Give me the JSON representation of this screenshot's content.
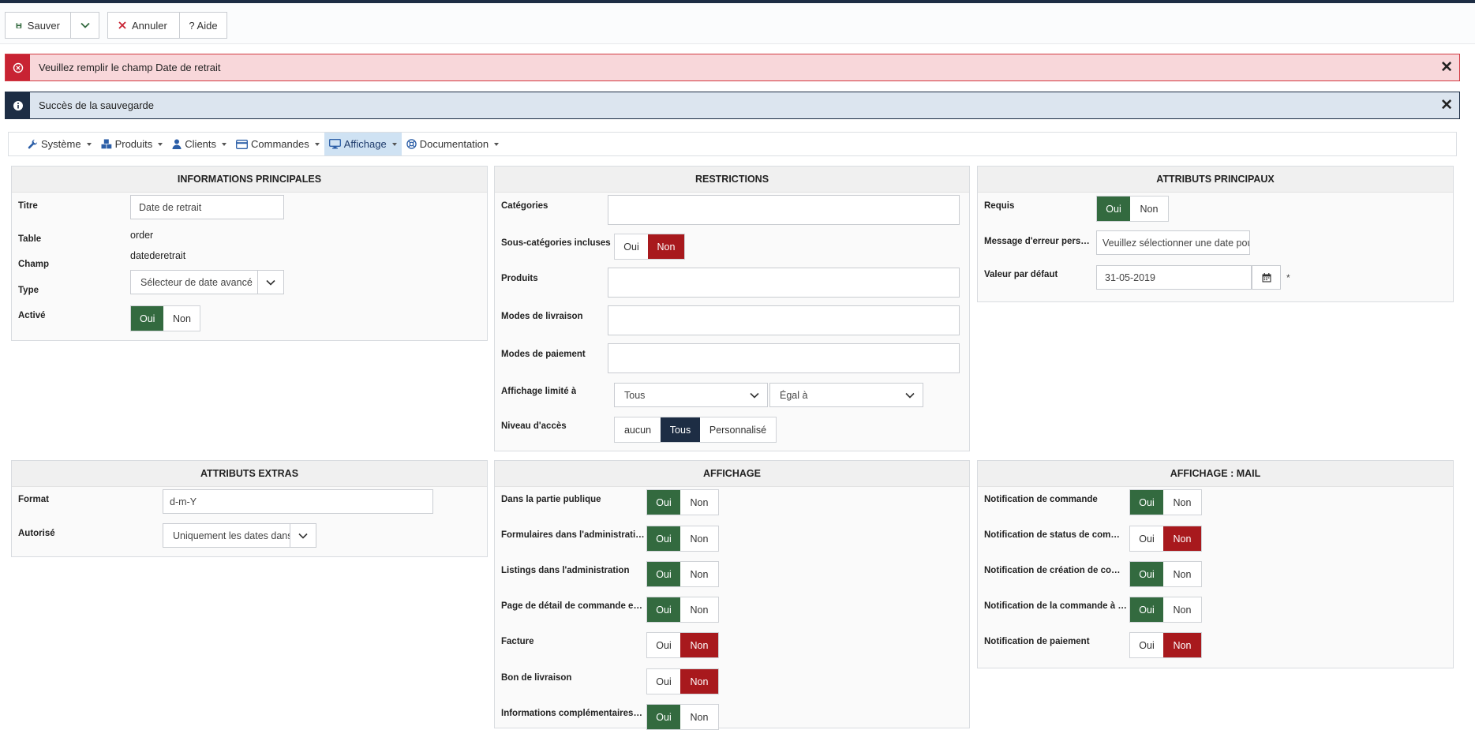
{
  "toolbar": {
    "save": "Sauver",
    "cancel": "Annuler",
    "help": "? Aide"
  },
  "alerts": {
    "error": "Veuillez remplir le champ Date de retrait",
    "success": "Succès de la sauvegarde",
    "close": "✕"
  },
  "menu": {
    "items": [
      {
        "label": "Système"
      },
      {
        "label": "Produits"
      },
      {
        "label": "Clients"
      },
      {
        "label": "Commandes"
      },
      {
        "label": "Affichage"
      },
      {
        "label": "Documentation"
      }
    ],
    "active": "Affichage"
  },
  "main_info": {
    "title": "INFORMATIONS PRINCIPALES",
    "labels": {
      "titre": "Titre",
      "table": "Table",
      "champ": "Champ",
      "type": "Type",
      "active": "Activé"
    },
    "values": {
      "titre": "Date de retrait",
      "table": "order",
      "champ": "datederetrait",
      "type": "Sélecteur de date avancé"
    },
    "active_toggle": {
      "yes": "Oui",
      "no": "Non",
      "selected": "Oui"
    }
  },
  "restrictions": {
    "title": "RESTRICTIONS",
    "labels": {
      "categories": "Catégories",
      "subcats": "Sous-catégories incluses",
      "products": "Produits",
      "delivery": "Modes de livraison",
      "payment": "Modes de paiement",
      "display_limited": "Affichage limité à",
      "access": "Niveau d'accès"
    },
    "subcats_toggle": {
      "yes": "Oui",
      "no": "Non",
      "selected": "Non"
    },
    "display_limited_select1": "Tous",
    "display_limited_select2": "Égal à",
    "access_options": [
      "aucun",
      "Tous",
      "Personnalisé"
    ],
    "access_selected": "Tous"
  },
  "main_attrs": {
    "title": "ATTRIBUTS PRINCIPAUX",
    "labels": {
      "required": "Requis",
      "error_msg": "Message d'erreur personnalisé",
      "default": "Valeur par défaut"
    },
    "required_toggle": {
      "yes": "Oui",
      "no": "Non",
      "selected": "Oui"
    },
    "error_msg_value": "Veuillez sélectionner une date pour le retrait",
    "default_value": "31-05-2019",
    "required_marker": "*"
  },
  "extra_attrs": {
    "title": "ATTRIBUTS EXTRAS",
    "labels": {
      "format": "Format",
      "allowed": "Autorisé"
    },
    "format_value": "d-m-Y",
    "allowed_value": "Uniquement les dates dans le futur"
  },
  "display": {
    "title": "AFFICHAGE",
    "rows": [
      {
        "label": "Dans la partie publique",
        "selected": "Oui"
      },
      {
        "label": "Formulaires dans l'administration",
        "selected": "Oui"
      },
      {
        "label": "Listings dans l'administration",
        "selected": "Oui"
      },
      {
        "label": "Page de détail de commande en partie publique",
        "selected": "Oui"
      },
      {
        "label": "Facture",
        "selected": "Non"
      },
      {
        "label": "Bon de livraison",
        "selected": "Non"
      },
      {
        "label": "Informations complémentaires de commande",
        "selected": "Oui"
      }
    ],
    "yes": "Oui",
    "no": "Non"
  },
  "display_mail": {
    "title": "AFFICHAGE : MAIL",
    "rows": [
      {
        "label": "Notification de commande",
        "selected": "Oui"
      },
      {
        "label": "Notification de status de commande",
        "selected": "Non"
      },
      {
        "label": "Notification de création de commande",
        "selected": "Oui"
      },
      {
        "label": "Notification de la commande à l'administrateur",
        "selected": "Oui"
      },
      {
        "label": "Notification de paiement",
        "selected": "Non"
      }
    ],
    "yes": "Oui",
    "no": "Non"
  },
  "colors": {
    "green": "#336a3f",
    "red": "#a8191d",
    "navy": "#1d2d44",
    "active_menu": "#cfe2f3"
  }
}
